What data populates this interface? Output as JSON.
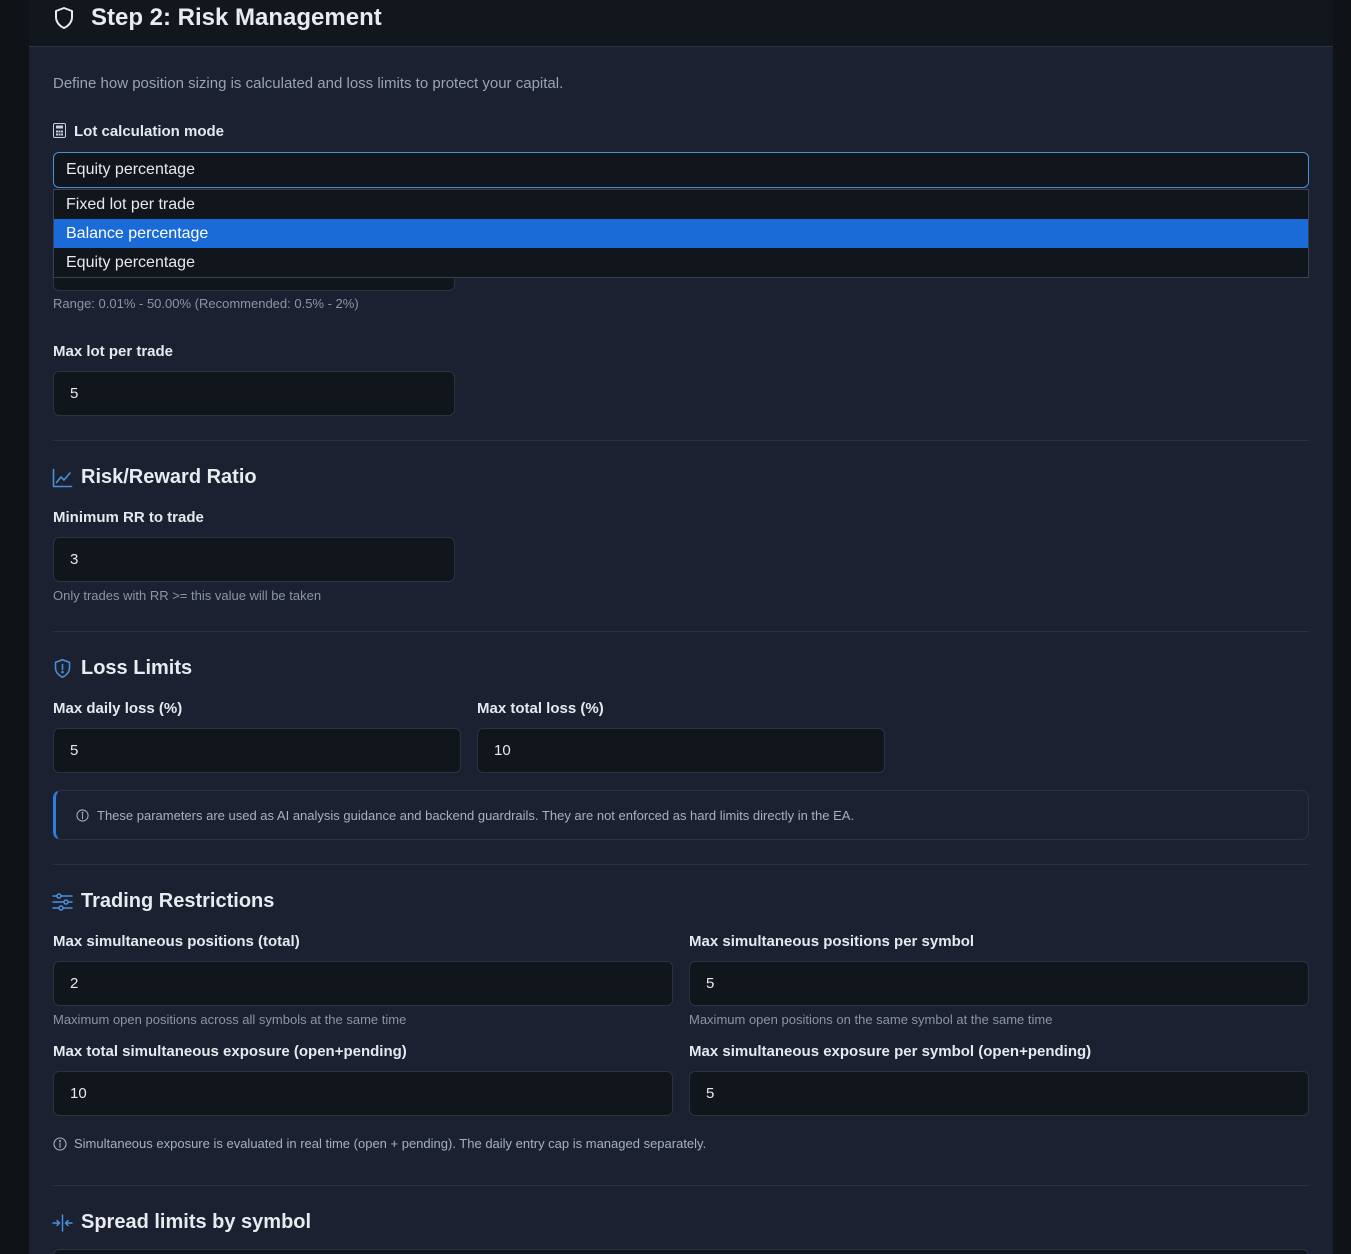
{
  "header": {
    "title": "Step 2: Risk Management",
    "icon": "shield-icon"
  },
  "intro": "Define how position sizing is calculated and loss limits to protect your capital.",
  "lot_mode": {
    "label": "Lot calculation mode",
    "icon": "calculator-icon",
    "selected": "Equity percentage",
    "options": [
      "Fixed lot per trade",
      "Balance percentage",
      "Equity percentage"
    ],
    "highlighted_index": 1
  },
  "risk_percent": {
    "help": "Range: 0.01% - 50.00% (Recommended: 0.5% - 2%)"
  },
  "max_lot": {
    "label": "Max lot per trade",
    "value": "5"
  },
  "rr": {
    "title": "Risk/Reward Ratio",
    "icon": "line-chart-icon",
    "label": "Minimum RR to trade",
    "value": "3",
    "help": "Only trades with RR >= this value will be taken"
  },
  "loss_limits": {
    "title": "Loss Limits",
    "icon": "shield-alert-icon",
    "daily_label": "Max daily loss (%)",
    "daily_value": "5",
    "total_label": "Max total loss (%)",
    "total_value": "10",
    "callout": "These parameters are used as AI analysis guidance and backend guardrails. They are not enforced as hard limits directly in the EA."
  },
  "restrictions": {
    "title": "Trading Restrictions",
    "icon": "sliders-icon",
    "pos_total_label": "Max simultaneous positions (total)",
    "pos_total_value": "2",
    "pos_total_help": "Maximum open positions across all symbols at the same time",
    "pos_symbol_label": "Max simultaneous positions per symbol",
    "pos_symbol_value": "5",
    "pos_symbol_help": "Maximum open positions on the same symbol at the same time",
    "exp_total_label": "Max total simultaneous exposure (open+pending)",
    "exp_total_value": "10",
    "exp_symbol_label": "Max simultaneous exposure per symbol (open+pending)",
    "exp_symbol_value": "5",
    "note": "Simultaneous exposure is evaluated in real time (open + pending). The daily entry cap is managed separately."
  },
  "spread": {
    "title": "Spread limits by symbol",
    "icon": "compress-icon"
  },
  "colors": {
    "accent": "#4a90d9",
    "selected_option": "#1a6ad8",
    "panel": "#1b2130",
    "input": "#11151c"
  }
}
